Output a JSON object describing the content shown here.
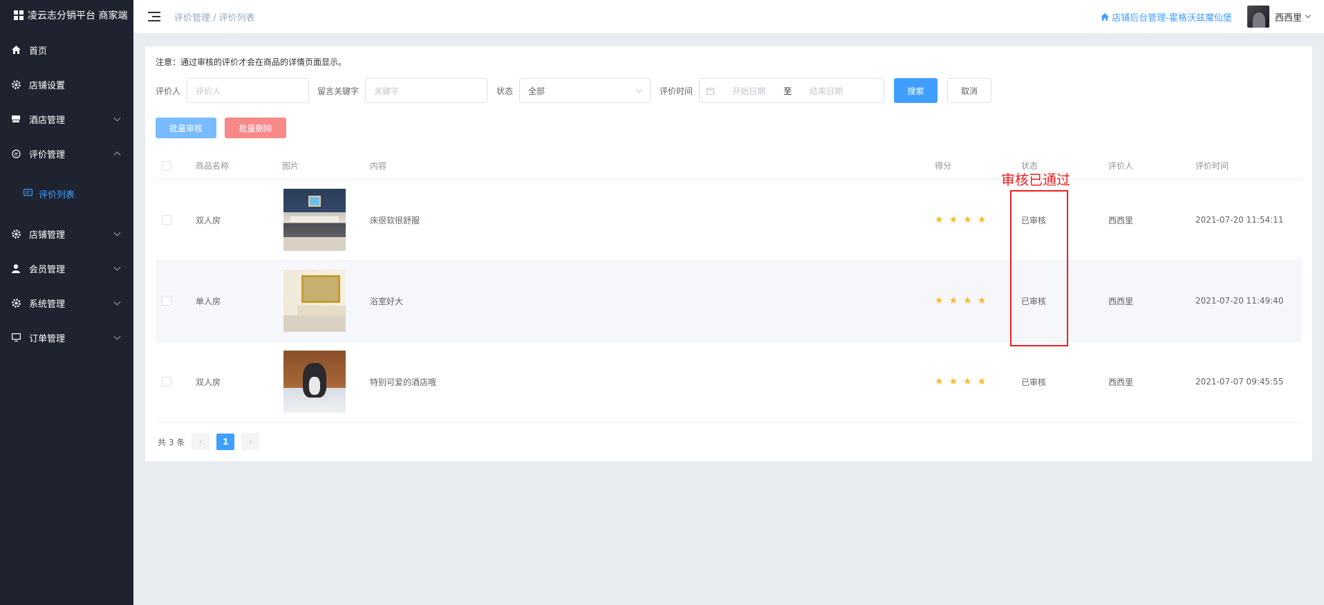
{
  "sidebar": {
    "brand": "凌云志分销平台 商家端",
    "items": [
      {
        "label": "首页",
        "icon": "home-icon"
      },
      {
        "label": "店铺设置",
        "icon": "gear-icon"
      },
      {
        "label": "酒店管理",
        "icon": "hotel-icon"
      },
      {
        "label": "评价管理",
        "icon": "comment-icon"
      },
      {
        "label": "店铺管理",
        "icon": "gear-icon"
      },
      {
        "label": "会员管理",
        "icon": "user-icon"
      },
      {
        "label": "系统管理",
        "icon": "gear-icon"
      },
      {
        "label": "订单管理",
        "icon": "monitor-icon"
      }
    ],
    "submenu_active": "评价列表"
  },
  "header": {
    "breadcrumb": "评价管理 / 评价列表",
    "store_link": "店铺后台管理-霍格沃兹魔仙堡",
    "username": "西西里"
  },
  "main": {
    "notice": "注意：通过审核的评价才会在商品的详情页面显示。",
    "filters": {
      "reviewer_label": "评价人",
      "reviewer_placeholder": "评价人",
      "keyword_label": "留言关键字",
      "keyword_placeholder": "关键字",
      "status_label": "状态",
      "status_value": "全部",
      "time_label": "评价时间",
      "start_placeholder": "开始日期",
      "range_sep": "至",
      "end_placeholder": "结束日期",
      "search_label": "搜索",
      "cancel_label": "取消"
    },
    "batch_approve_label": "批量审核",
    "batch_delete_label": "批量删除",
    "table": {
      "columns": [
        "商品名称",
        "图片",
        "内容",
        "得分",
        "状态",
        "评价人",
        "评价时间"
      ],
      "rows": [
        {
          "name": "双人房",
          "content": "床很软很舒服",
          "stars": 4,
          "status": "已审核",
          "reviewer": "西西里",
          "time": "2021-07-20 11:54:11"
        },
        {
          "name": "单人房",
          "content": "浴室好大",
          "stars": 4,
          "status": "已审核",
          "reviewer": "西西里",
          "time": "2021-07-20 11:49:40"
        },
        {
          "name": "双人房",
          "content": "特别可爱的酒店哦",
          "stars": 4,
          "status": "已审核",
          "reviewer": "西西里",
          "time": "2021-07-07 09:45:55"
        }
      ]
    },
    "pagination": {
      "total": "共 3 条",
      "current": "1"
    }
  },
  "annotation": {
    "text": "审核已通过"
  },
  "colors": {
    "accent": "#409eff",
    "danger": "#f56c6c",
    "star": "#f7ba2a",
    "annotation": "#f01c1c",
    "sidebar": "#1f2330"
  }
}
